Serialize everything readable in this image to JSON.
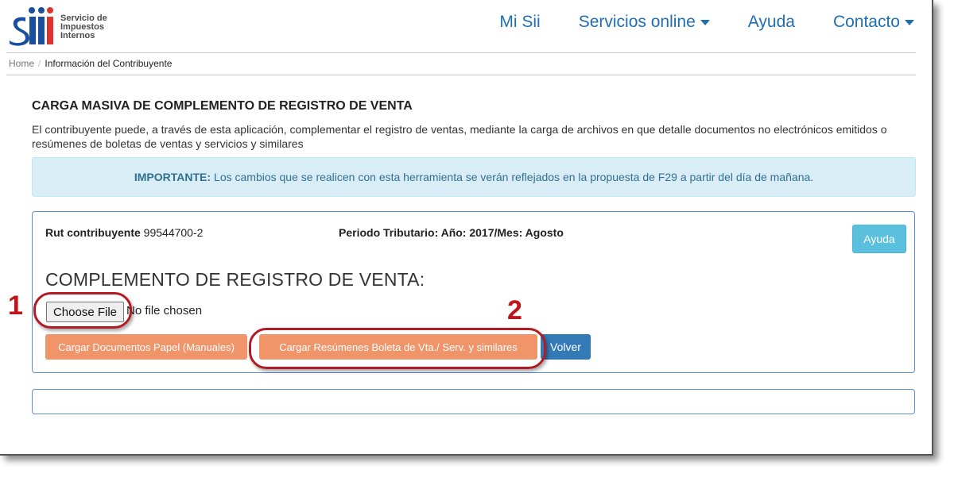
{
  "header": {
    "logo_text": [
      "Servicio de",
      "Impuestos",
      "Internos"
    ],
    "nav": [
      {
        "label": "Mi Sii",
        "has_caret": false
      },
      {
        "label": "Servicios online",
        "has_caret": true
      },
      {
        "label": "Ayuda",
        "has_caret": false
      },
      {
        "label": "Contacto",
        "has_caret": true
      }
    ]
  },
  "breadcrumb": {
    "home": "Home",
    "separator": "/",
    "current": "Información del Contribuyente"
  },
  "page": {
    "title": "CARGA MASIVA DE COMPLEMENTO DE REGISTRO DE VENTA",
    "description": "El contribuyente puede, a través de esta aplicación, complementar el registro de ventas, mediante la carga de archivos en que detalle documentos no electrónicos emitidos o resúmenes de boletas de ventas y servicios y similares"
  },
  "alert": {
    "strong": "IMPORTANTE:",
    "text": "Los cambios que se realicen con esta herramienta se verán reflejados en la propuesta de F29 a partir del día de mañana."
  },
  "panel": {
    "rut_label": "Rut contribuyente",
    "rut_value": "99544700-2",
    "periodo": "Periodo Tributario: Año: 2017/Mes: Agosto",
    "help_button": "Ayuda",
    "section_title": "COMPLEMENTO DE REGISTRO DE VENTA:",
    "file_button": "Choose File",
    "file_status": "No file chosen",
    "btn_papel": "Cargar Documentos Papel (Manuales)",
    "btn_resumen": "Cargar Resúmenes Boleta de Vta./ Serv. y similares",
    "btn_volver": "Volver"
  },
  "annotations": {
    "one": "1",
    "two": "2"
  },
  "colors": {
    "nav_blue": "#1f6fb0",
    "alert_bg": "#d9edf7",
    "orange_button": "#f0956a",
    "blue_button": "#337ab7",
    "info_button": "#5bc0de",
    "annotation_red": "#c0141d"
  }
}
